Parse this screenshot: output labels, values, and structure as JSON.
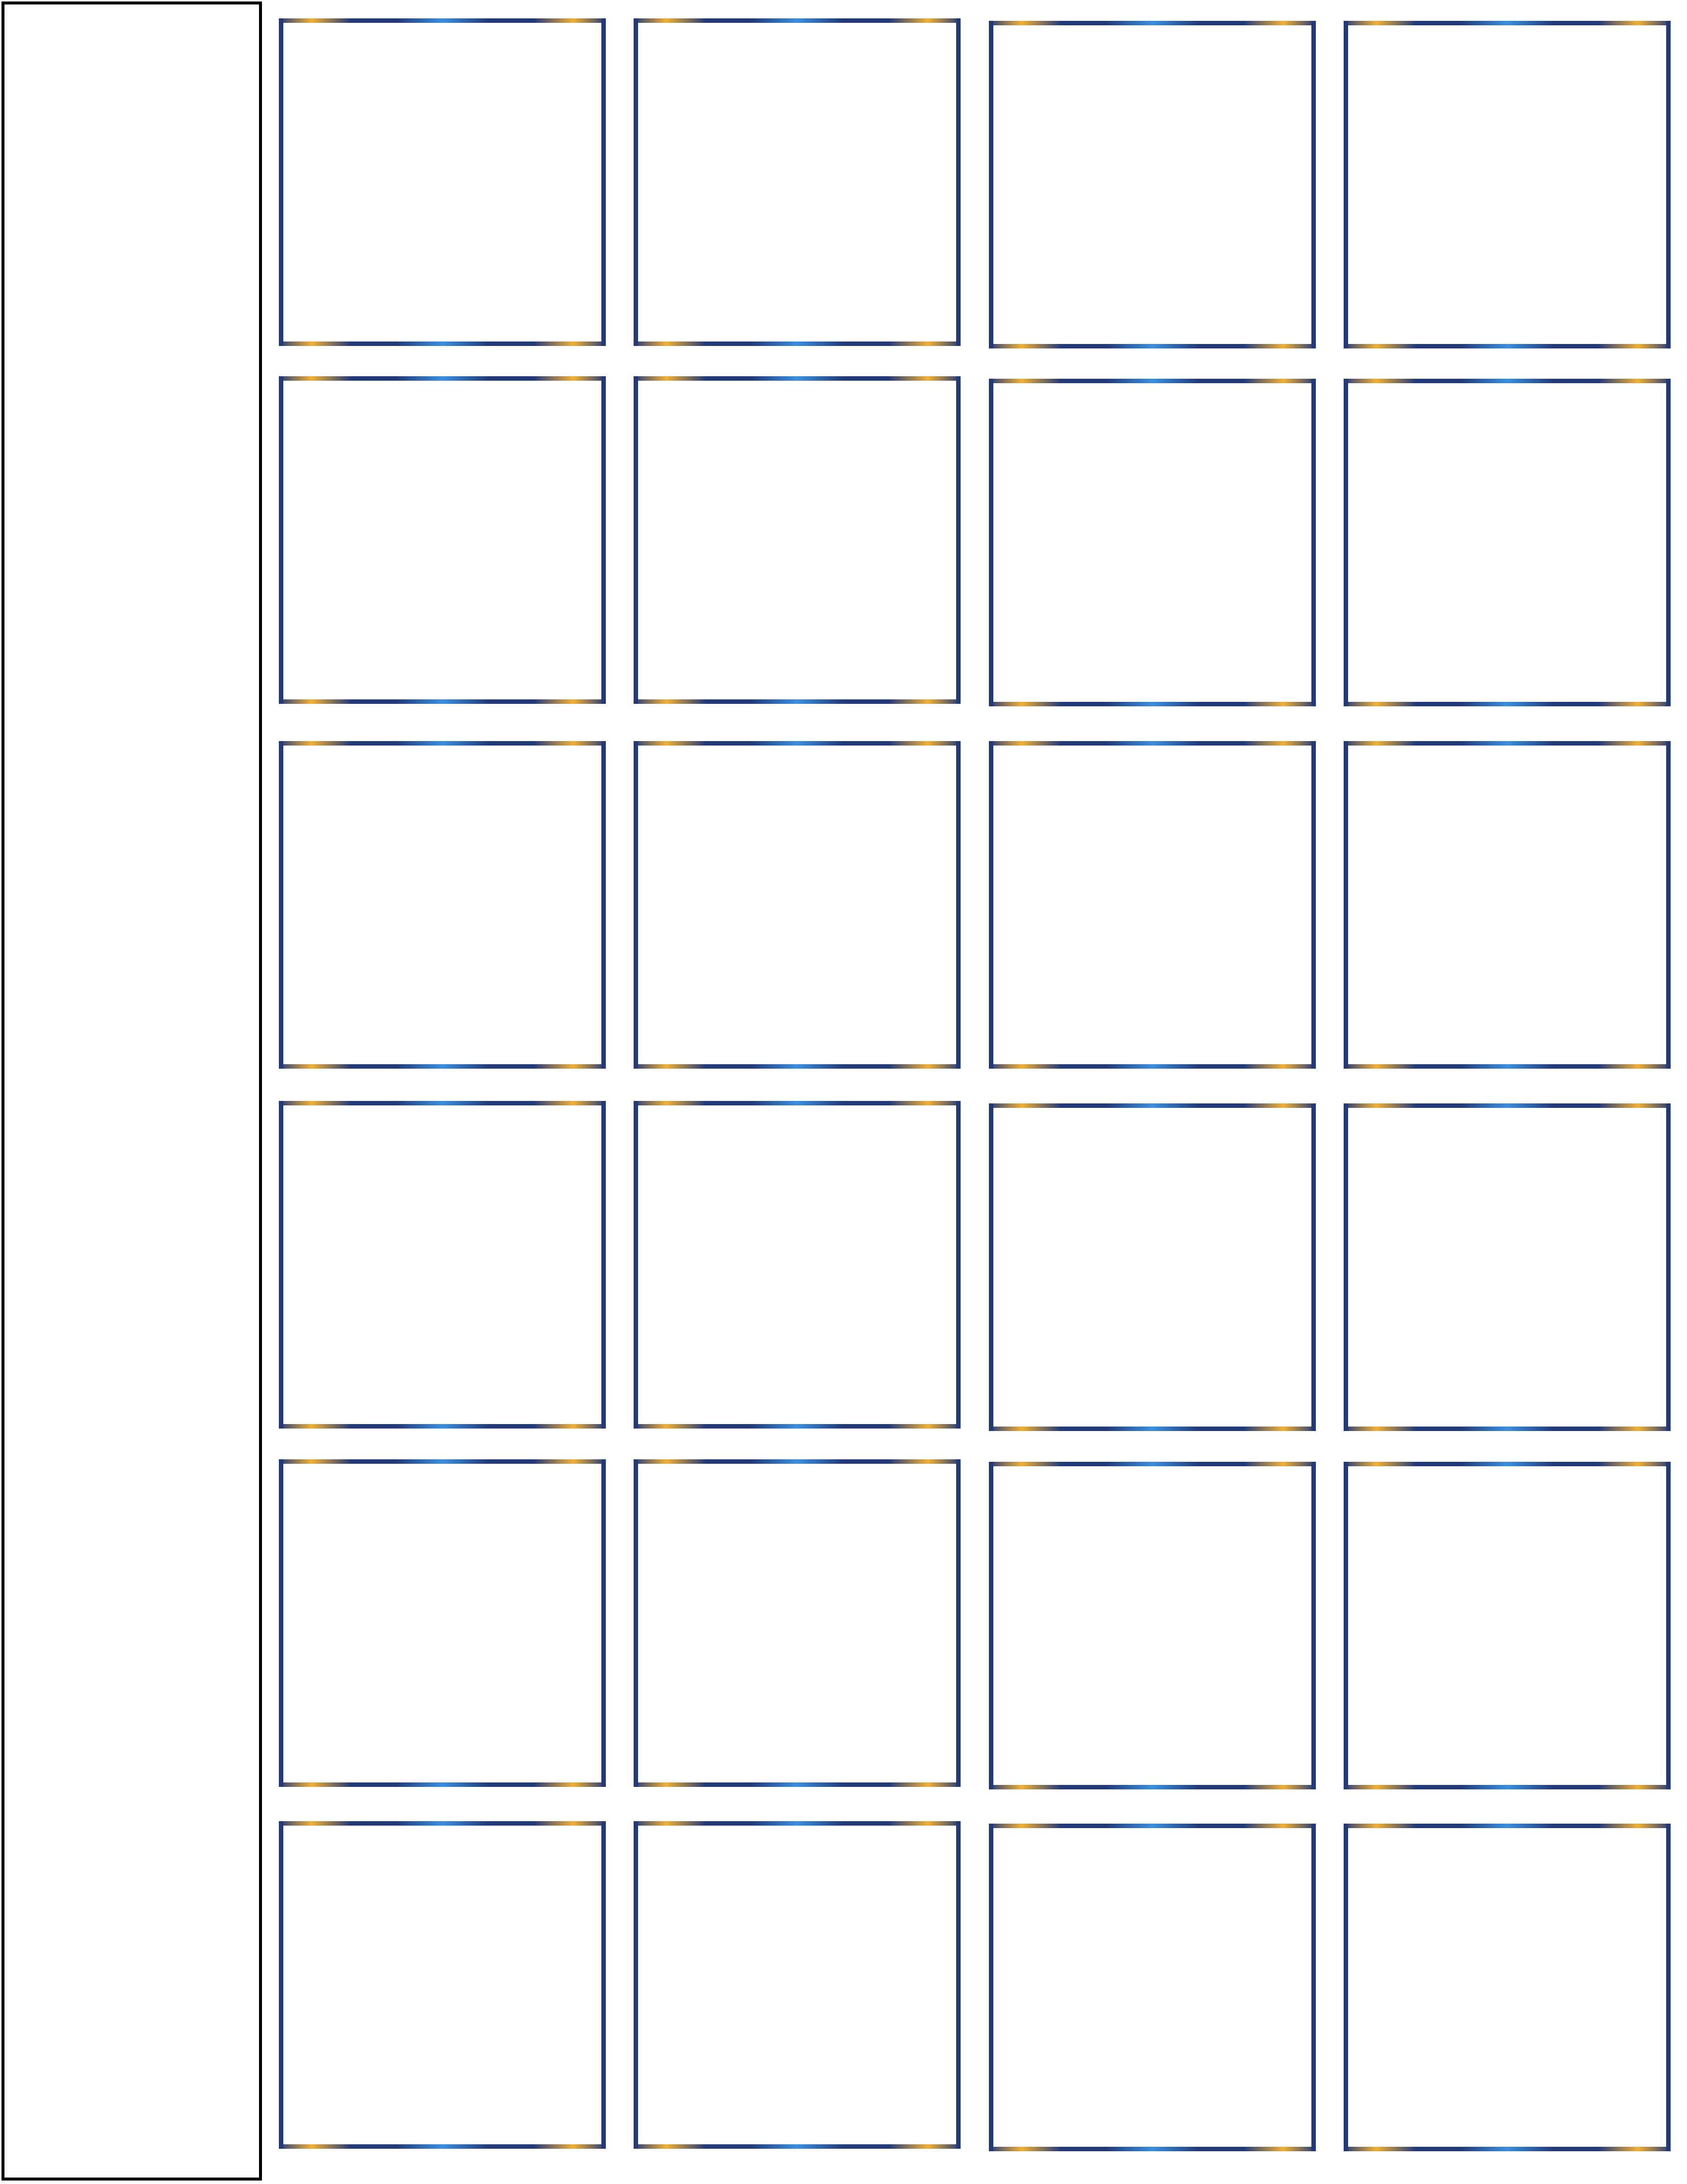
{
  "page": {
    "background": "#ffffff"
  },
  "side_panel": {
    "border_color": "#000000"
  },
  "cells": {
    "rows": 6,
    "columns": 4,
    "count": 24,
    "frame_colors": {
      "primary": "#223a7a",
      "highlight": "#3a8fe0",
      "accent": "#f2b134"
    }
  }
}
